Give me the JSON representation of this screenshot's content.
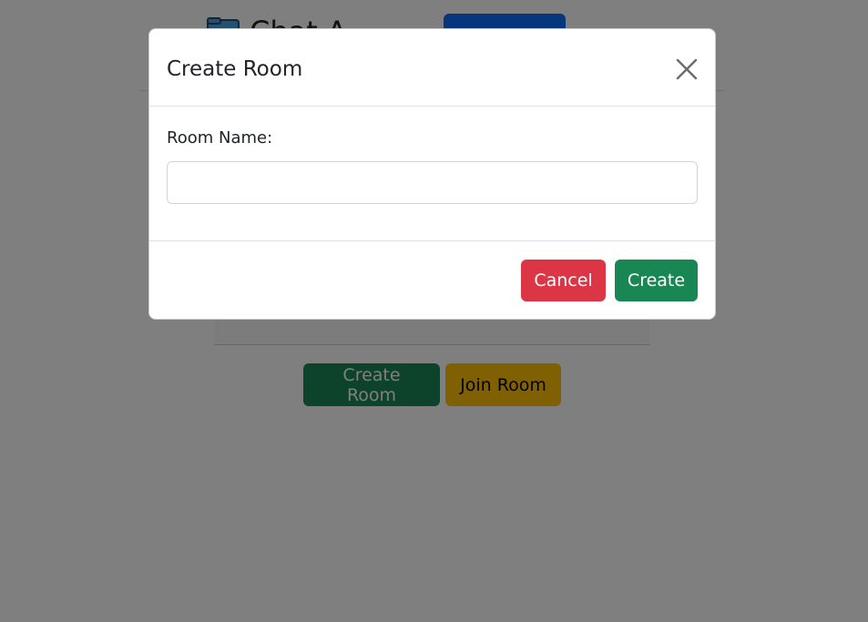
{
  "background": {
    "navbar": {
      "brand_text": "Chat A",
      "brand_icon": "folder-chat-icon"
    },
    "actions": {
      "create_room_label": "Create Room",
      "join_room_label": "Join Room"
    }
  },
  "modal": {
    "title": "Create Room",
    "close_icon": "close-icon",
    "room_name_label": "Room Name:",
    "room_name_value": "",
    "cancel_label": "Cancel",
    "create_label": "Create"
  },
  "colors": {
    "backdrop": "#808080",
    "danger": "#dc3545",
    "success": "#198754",
    "warning": "#ffc107",
    "primary": "#0d6efd"
  }
}
